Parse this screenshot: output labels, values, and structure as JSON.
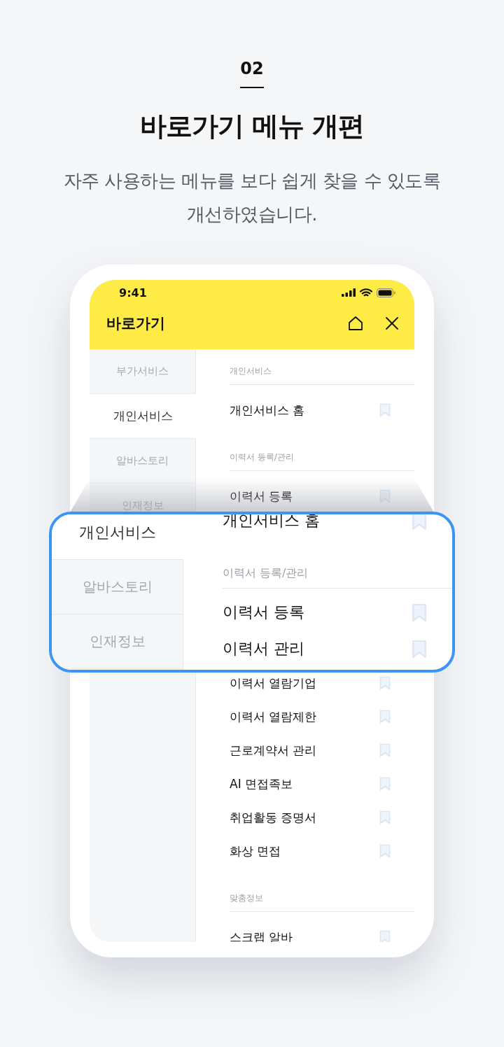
{
  "step_number": "02",
  "title": "바로가기 메뉴 개편",
  "description_lines": [
    "자주 사용하는 메뉴를 보다 쉽게 찾을 수 있도록",
    "개선하였습니다."
  ],
  "phone": {
    "status_bar": {
      "time": "9:41"
    },
    "header": {
      "title": "바로가기"
    },
    "sidebar": {
      "items": [
        {
          "label": "부가서비스",
          "selected": false
        },
        {
          "label": "개인서비스",
          "selected": true
        },
        {
          "label": "알바스토리",
          "selected": false
        },
        {
          "label": "인재정보",
          "selected": false
        }
      ]
    },
    "content_above": [
      {
        "kind": "section",
        "label": "개인서비스"
      },
      {
        "kind": "item",
        "label": "개인서비스 홈"
      },
      {
        "kind": "section",
        "label": "이력서 등록/관리"
      },
      {
        "kind": "item",
        "label": "이력서 등록"
      }
    ],
    "content_below": [
      {
        "kind": "item",
        "label": "이력서 열람기업"
      },
      {
        "kind": "item",
        "label": "이력서 열람제한"
      },
      {
        "kind": "item",
        "label": "근로계약서 관리"
      },
      {
        "kind": "item",
        "label": "AI 면접족보"
      },
      {
        "kind": "item",
        "label": "취업활동 증명서"
      },
      {
        "kind": "item",
        "label": "화상 면접"
      },
      {
        "kind": "section",
        "label": "맞춤정보"
      },
      {
        "kind": "item",
        "label": "스크랩 알바"
      }
    ]
  },
  "magnifier": {
    "sidebar": {
      "items": [
        {
          "label": "개인서비스",
          "selected": true
        },
        {
          "label": "알바스토리",
          "selected": false
        },
        {
          "label": "인재정보",
          "selected": false
        }
      ]
    },
    "content": [
      {
        "kind": "item",
        "label": "개인서비스 홈"
      },
      {
        "kind": "section",
        "label": "이력서 등록/관리"
      },
      {
        "kind": "item",
        "label": "이력서 등록"
      },
      {
        "kind": "item",
        "label": "이력서 관리"
      }
    ]
  }
}
